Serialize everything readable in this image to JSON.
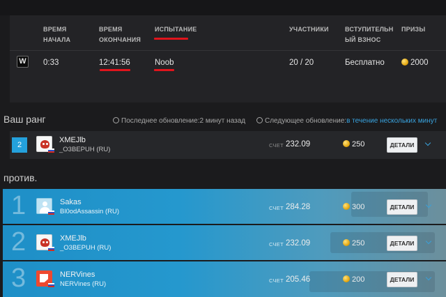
{
  "table": {
    "headers": {
      "start_line1": "ВРЕМЯ",
      "start_line2": "НАЧАЛА",
      "end_line1": "ВРЕМЯ",
      "end_line2": "ОКОНЧАНИЯ",
      "challenge": "ИСПЫТАНИЕ",
      "participants": "УЧАСТНИКИ",
      "fee_line1": "ВСТУПИТЕЛЬН",
      "fee_line2": "ЫЙ ВЗНОС",
      "prizes": "ПРИЗЫ"
    },
    "row": {
      "logo_letter": "W",
      "start_time": "0:33",
      "end_time": "12:41:56",
      "challenge": "Noob",
      "participants": "20 / 20",
      "fee": "Бесплатно",
      "prize": "2000"
    }
  },
  "your_rank": {
    "title": "Ваш ранг",
    "last_update": "Последнее обновление:2 минут назад",
    "next_update_label": "Следующее обновление:",
    "next_update_value": "в течение нескольких минут",
    "rank": "2",
    "player": "XMEJlb",
    "clan": "_O3BEPUH (RU)",
    "score_label": "СЧЕТ",
    "score": "232.09",
    "prize": "250",
    "details_label": "ДЕТАЛИ"
  },
  "versus": {
    "title": "против.",
    "rows": [
      {
        "rank": "1",
        "player": "Sakas",
        "clan": "Bl0odAssassin (RU)",
        "score_label": "СЧЕТ",
        "score": "284.28",
        "prize": "300",
        "details_label": "ДЕТАЛИ"
      },
      {
        "rank": "2",
        "player": "XMEJlb",
        "clan": "_O3BEPUH (RU)",
        "score_label": "СЧЕТ",
        "score": "232.09",
        "prize": "250",
        "details_label": "ДЕТАЛИ"
      },
      {
        "rank": "3",
        "player": "NERVines",
        "clan": "NERVines (RU)",
        "score_label": "СЧЕТ",
        "score": "205.46",
        "prize": "200",
        "details_label": "ДЕТАЛИ"
      }
    ]
  },
  "colors": {
    "accent": "#24a1dc",
    "underline": "#e0141c",
    "link": "#39a3df"
  },
  "icons": [
    "game-logo-icon",
    "coin-icon",
    "clock-icon",
    "chevron-down-icon",
    "avatar-icon",
    "flag-ru-icon"
  ]
}
